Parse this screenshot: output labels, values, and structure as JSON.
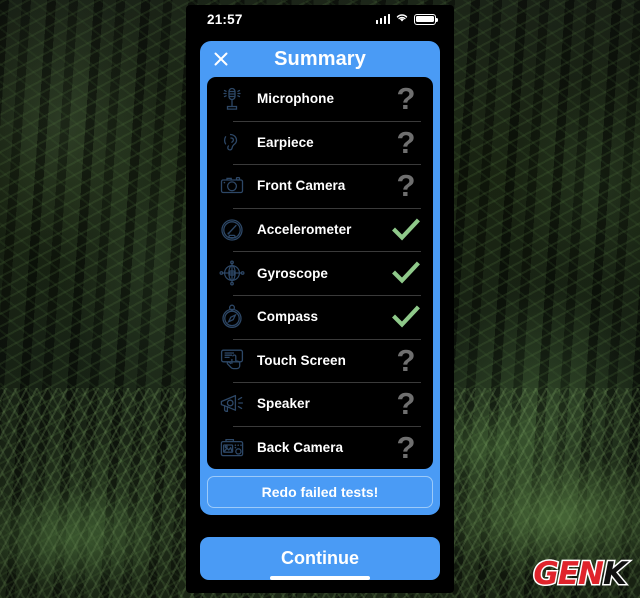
{
  "background": {
    "scene": "dark-forest-photo",
    "watermark": {
      "part1": "GEN",
      "part2": "K",
      "color1": "#e0232b",
      "color2": "#111111"
    }
  },
  "phone": {
    "status_bar": {
      "time": "21:57",
      "cellular_icon": "cellular-signal-icon",
      "wifi_icon": "wifi-icon",
      "battery_icon": "battery-full-icon"
    },
    "home_indicator": "home-indicator"
  },
  "modal": {
    "title": "Summary",
    "close_icon": "close-icon",
    "accent_color": "#4a9bf5",
    "tests": [
      {
        "label": "Microphone",
        "icon": "microphone-icon",
        "status": "unknown",
        "status_glyph": "?"
      },
      {
        "label": "Earpiece",
        "icon": "earpiece-icon",
        "status": "unknown",
        "status_glyph": "?"
      },
      {
        "label": "Front Camera",
        "icon": "front-camera-icon",
        "status": "unknown",
        "status_glyph": "?"
      },
      {
        "label": "Accelerometer",
        "icon": "accelerometer-icon",
        "status": "pass",
        "status_glyph": "✓"
      },
      {
        "label": "Gyroscope",
        "icon": "gyroscope-icon",
        "status": "pass",
        "status_glyph": "✓"
      },
      {
        "label": "Compass",
        "icon": "compass-icon",
        "status": "pass",
        "status_glyph": "✓"
      },
      {
        "label": "Touch Screen",
        "icon": "touch-screen-icon",
        "status": "unknown",
        "status_glyph": "?"
      },
      {
        "label": "Speaker",
        "icon": "speaker-icon",
        "status": "unknown",
        "status_glyph": "?"
      },
      {
        "label": "Back Camera",
        "icon": "back-camera-icon",
        "status": "unknown",
        "status_glyph": "?"
      }
    ],
    "redo_label": "Redo failed tests!"
  },
  "footer": {
    "continue_label": "Continue"
  },
  "colors": {
    "accent_blue": "#4a9bf5",
    "pass_green": "#8fc98a",
    "unknown_gray": "#6f6f6f",
    "icon_blue": "#2d4766",
    "panel_black": "#000000"
  }
}
